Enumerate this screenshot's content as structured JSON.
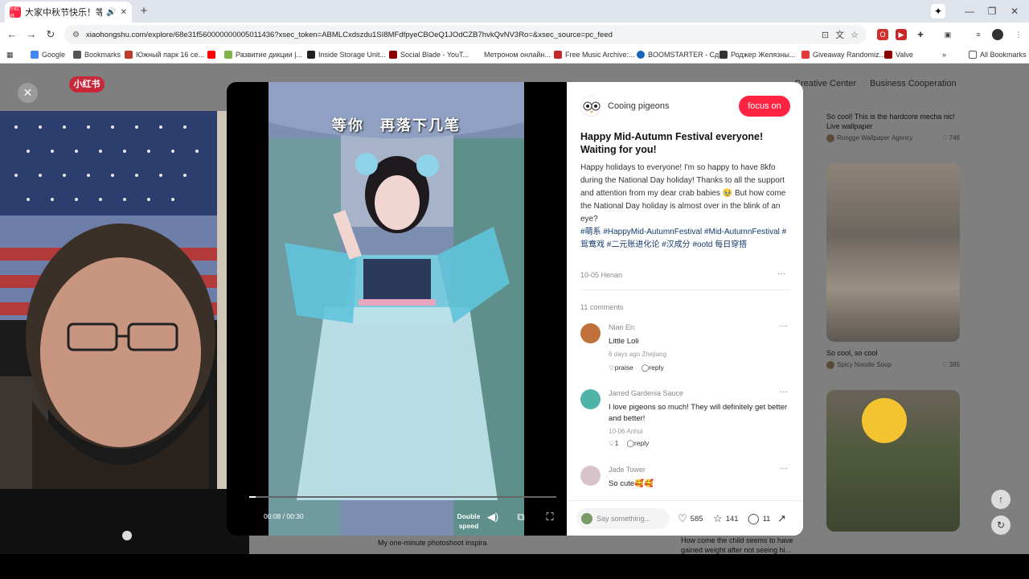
{
  "browser": {
    "tab_title": "大家中秋节快乐！等你！ -",
    "tab_favicon_text": "小红书",
    "url_site_icon": "site-info-icon",
    "url": "xiaohongshu.com/explore/68e31f560000000005011436?xsec_token=ABMLCxdszdu1SI8MFdfpyeCBOeQ1JOdCZB7hvkQvNV3Ro=&xsec_source=pc_feed",
    "bookmarks": [
      {
        "label": "Google",
        "color": "#4285f4"
      },
      {
        "label": "Bookmarks",
        "color": "#555555"
      },
      {
        "label": "Южный парк 16 се...",
        "color": "#c0392b"
      },
      {
        "label": "",
        "color": "#ff0000"
      },
      {
        "label": "Развитие дикции |...",
        "color": "#7cb342"
      },
      {
        "label": "Inside Storage Unit...",
        "color": "#222222"
      },
      {
        "label": "Social Blade - YouT...",
        "color": "#8b0000"
      },
      {
        "label": "Метроном онлайн...",
        "color": "#ffffff"
      },
      {
        "label": "Free Music Archive:...",
        "color": "#c62828"
      },
      {
        "label": "BOOMSTARTER - Сд...",
        "color": "#1565c0"
      },
      {
        "label": "Роджер Желязны...",
        "color": "#333333"
      },
      {
        "label": "Giveaway Randomiz...",
        "color": "#e53935"
      },
      {
        "label": "Valve",
        "color": "#8b0000"
      }
    ],
    "all_bookmarks": "All Bookmarks"
  },
  "page": {
    "logo": "小红书",
    "nav": [
      "Creative Center",
      "Business Cooperation"
    ],
    "cards": [
      {
        "caption": "So cool! This is the hardcore mecha nic! Live wallpaper",
        "author": "Rongge Wallpaper Agency",
        "likes": "746"
      },
      {
        "caption": "So cool, so cool",
        "author": "Spicy Noodle Soup",
        "likes": "385"
      },
      {
        "caption": "How come the child seems to have gained weight after not seeing hi...",
        "author": "",
        "likes": ""
      },
      {
        "caption": "My one-minute photoshoot inspira",
        "author": "",
        "likes": ""
      }
    ]
  },
  "video": {
    "caption": "等你　再落下几笔",
    "time": "00:08 / 00:30",
    "progress": 0.02,
    "speed_label": "Double speed"
  },
  "note": {
    "author": "Cooing pigeons",
    "follow_label": "focus on",
    "title": "Happy Mid-Autumn Festival everyone! Waiting for you!",
    "body": "Happy holidays to everyone! I'm so happy to have 8kfo during the National Day holiday! Thanks to all the support and attention from my dear crab babies 🥹 But how come the National Day holiday is almost over in the blink of an eye?",
    "tags": " #萌系 #HappyMid-AutumnFestival #Mid-AutumnFestival #鸳鸯戏 #二元账进化论 #汉成分 #ootd 每日穿搭",
    "date": "10-05 Henan",
    "comments_count": "11 comments",
    "comments": [
      {
        "name": "Nian En",
        "text": "Little Loli",
        "meta": "6 days ago  Zhejiang",
        "like_label": "praise",
        "reply_label": "reply",
        "avatar_color": "#c0703a"
      },
      {
        "name": "Jarred Gardenia Sauce",
        "text": "I love pigeons so much! They will definitely get better and better!",
        "meta": "10-06  Anhui",
        "like_label": "1",
        "reply_label": "reply",
        "avatar_color": "#4fb3a8"
      },
      {
        "name": "Jade Tower",
        "text": "So cute🥰🥰",
        "meta": "",
        "like_label": "",
        "reply_label": "",
        "avatar_color": "#d8c3c8"
      }
    ],
    "input_placeholder": "Say something...",
    "likes": "585",
    "stars": "141",
    "comments_total": "11"
  }
}
